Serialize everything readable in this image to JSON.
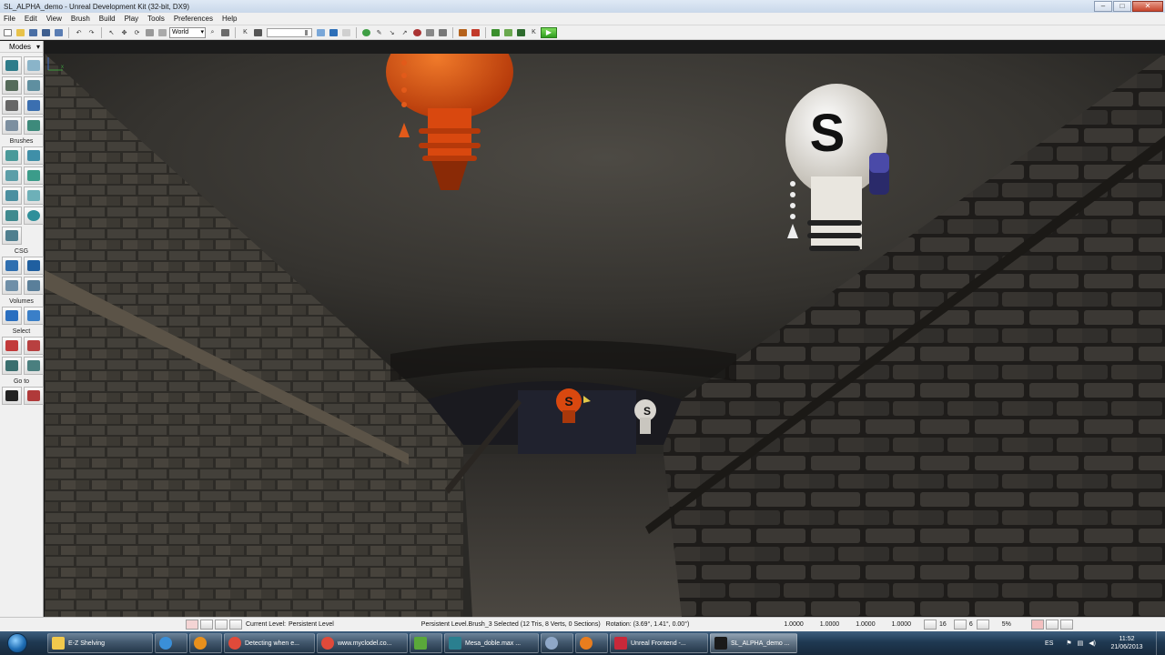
{
  "window": {
    "title": "SL_ALPHA_demo - Unreal Development Kit (32-bit, DX9)",
    "minimize": "–",
    "maximize": "□",
    "close": "✕"
  },
  "menu": [
    "File",
    "Edit",
    "View",
    "Brush",
    "Build",
    "Play",
    "Tools",
    "Preferences",
    "Help"
  ],
  "toolbar": {
    "coord_system": "World",
    "play_label": "▶"
  },
  "modes_panel": {
    "title": "Modes",
    "sections": {
      "brushes": "Brushes",
      "csg": "CSG",
      "volumes": "Volumes",
      "select": "Select",
      "goto": "Go to"
    }
  },
  "viewport": {
    "bulb_label": "S",
    "axis_label": "x"
  },
  "statusbar": {
    "current_level_label": "Current Level:",
    "current_level": "Persistent Level",
    "selection": "Persistent Level.Brush_3 Selected (12 Tris, 8 Verts, 0 Sections)",
    "rotation": "Rotation: (3.69°, 1.41°, 0.00°)",
    "drag_grid": [
      "1.0000",
      "1.0000",
      "1.0000",
      "1.0000"
    ],
    "grid_size": "16",
    "rotation_snap": "6",
    "scale_snap": "5%"
  },
  "taskbar": {
    "tasks": [
      "E-Z Shelving",
      "",
      "",
      "Detecting when e...",
      "www.myclodel.co...",
      "",
      "Mesa_doble.max ...",
      "",
      "",
      "Unreal Frontend -...",
      "SL_ALPHA_demo ..."
    ],
    "language": "ES",
    "time": "11:52",
    "date": "21/06/2013"
  },
  "colors": {
    "accent": "#1f6eb5",
    "bulb_orange": "#d9480f",
    "bulb_white": "#e9e6df"
  }
}
